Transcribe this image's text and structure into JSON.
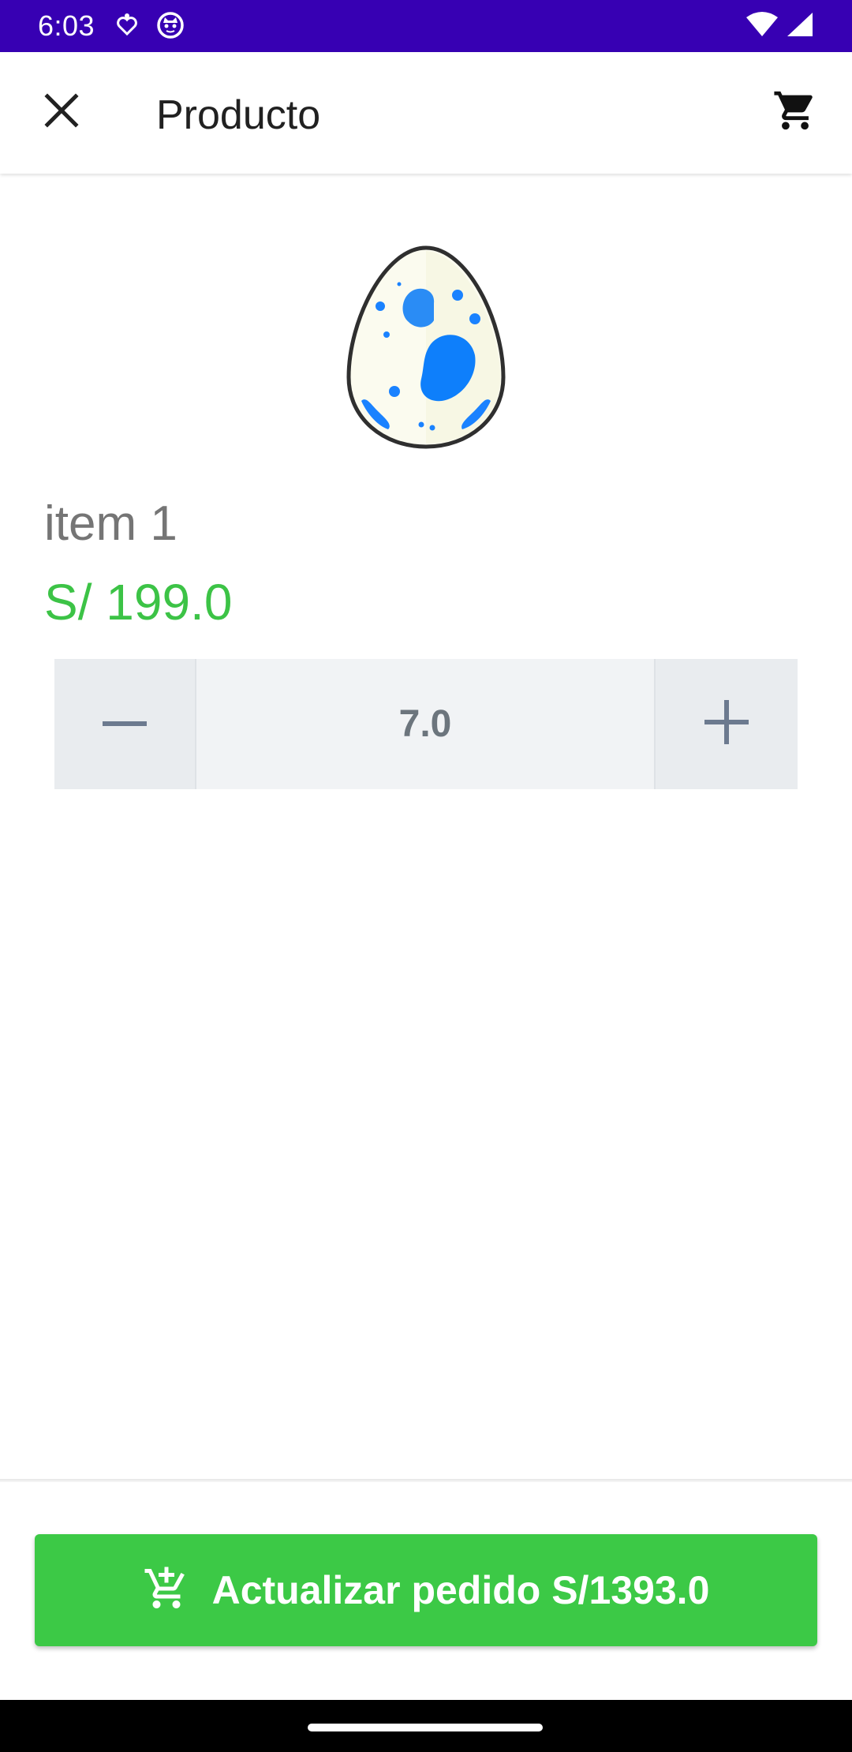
{
  "status_bar": {
    "time": "6:03",
    "icons_left": [
      "health-icon",
      "cat-face-icon"
    ],
    "icons_right": [
      "wifi-icon",
      "signal-icon"
    ]
  },
  "app_bar": {
    "title": "Producto",
    "close_icon": "close-icon",
    "cart_icon": "cart-icon"
  },
  "product": {
    "image": "egg-icon",
    "name": "item 1",
    "price": "S/ 199.0"
  },
  "quantity": {
    "value": "7.0",
    "decrement_icon": "minus-icon",
    "increment_icon": "plus-icon"
  },
  "action": {
    "label": "Actualizar pedido S/1393.0",
    "icon": "add-to-cart-icon"
  },
  "colors": {
    "status_bar": "#3700b3",
    "price": "#3cc346",
    "button": "#3cc946",
    "egg_spots": "#1a82ff"
  }
}
